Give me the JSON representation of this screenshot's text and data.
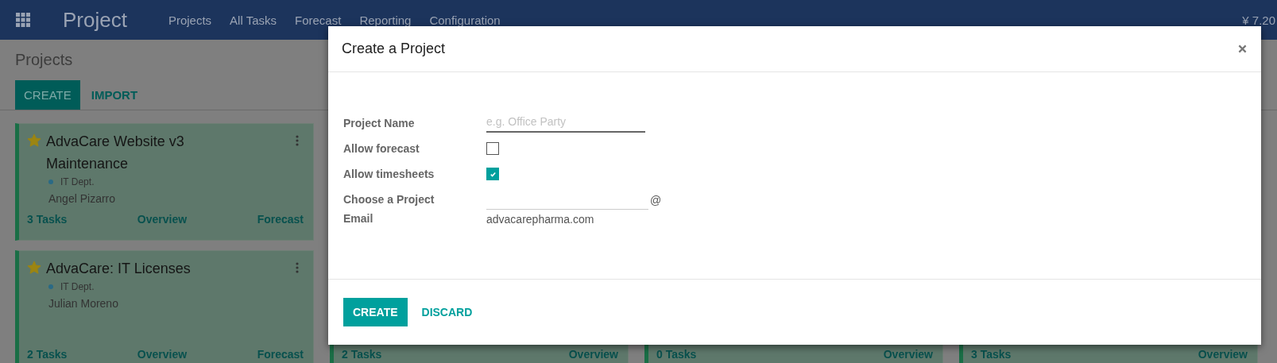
{
  "navbar": {
    "app_name": "Project",
    "menu": [
      "Projects",
      "All Tasks",
      "Forecast",
      "Reporting",
      "Configuration"
    ],
    "company": "¥ 7.20"
  },
  "control_panel": {
    "title": "Projects",
    "buttons": [
      {
        "label": "CREATE",
        "kind": "primary"
      },
      {
        "label": "IMPORT",
        "kind": "link"
      }
    ]
  },
  "columns": [
    {
      "cards": [
        {
          "favorite": true,
          "name": "AdvaCare Website v3 Maintenance",
          "tag": {
            "label": "IT Dept.",
            "color": "#2a6a85"
          },
          "manager": "Angel Pizarro",
          "links": [
            "3 Tasks",
            "Overview",
            "Forecast"
          ]
        },
        {
          "favorite": true,
          "name": "AdvaCare: IT Licenses",
          "tag": {
            "label": "IT Dept.",
            "color": "#2a6a85"
          },
          "manager": "Julian Moreno",
          "links": [
            "2 Tasks",
            "Overview",
            "Forecast"
          ]
        }
      ]
    },
    {
      "cards": [
        {
          "links": [
            "2 Tasks",
            "Overview"
          ]
        }
      ]
    },
    {
      "cards": [
        {
          "links": [
            "0 Tasks",
            "Overview"
          ]
        }
      ]
    },
    {
      "cards": [
        {
          "links": [
            "3 Tasks",
            "Overview"
          ]
        }
      ]
    }
  ],
  "dialog": {
    "title": "Create a Project",
    "fields": [
      {
        "kind": "text",
        "label": "Project Name",
        "placeholder": "e.g. Office Party"
      },
      {
        "kind": "checkbox",
        "label": "Allow forecast",
        "checked": false
      },
      {
        "kind": "checkbox",
        "label": "Allow timesheets",
        "checked": true
      },
      {
        "kind": "email",
        "label": "Choose a Project Email",
        "suffix": "@",
        "domain": "advacarepharma.com"
      }
    ],
    "buttons": [
      {
        "label": "CREATE",
        "kind": "primary"
      },
      {
        "label": "DISCARD",
        "kind": "link"
      }
    ]
  }
}
